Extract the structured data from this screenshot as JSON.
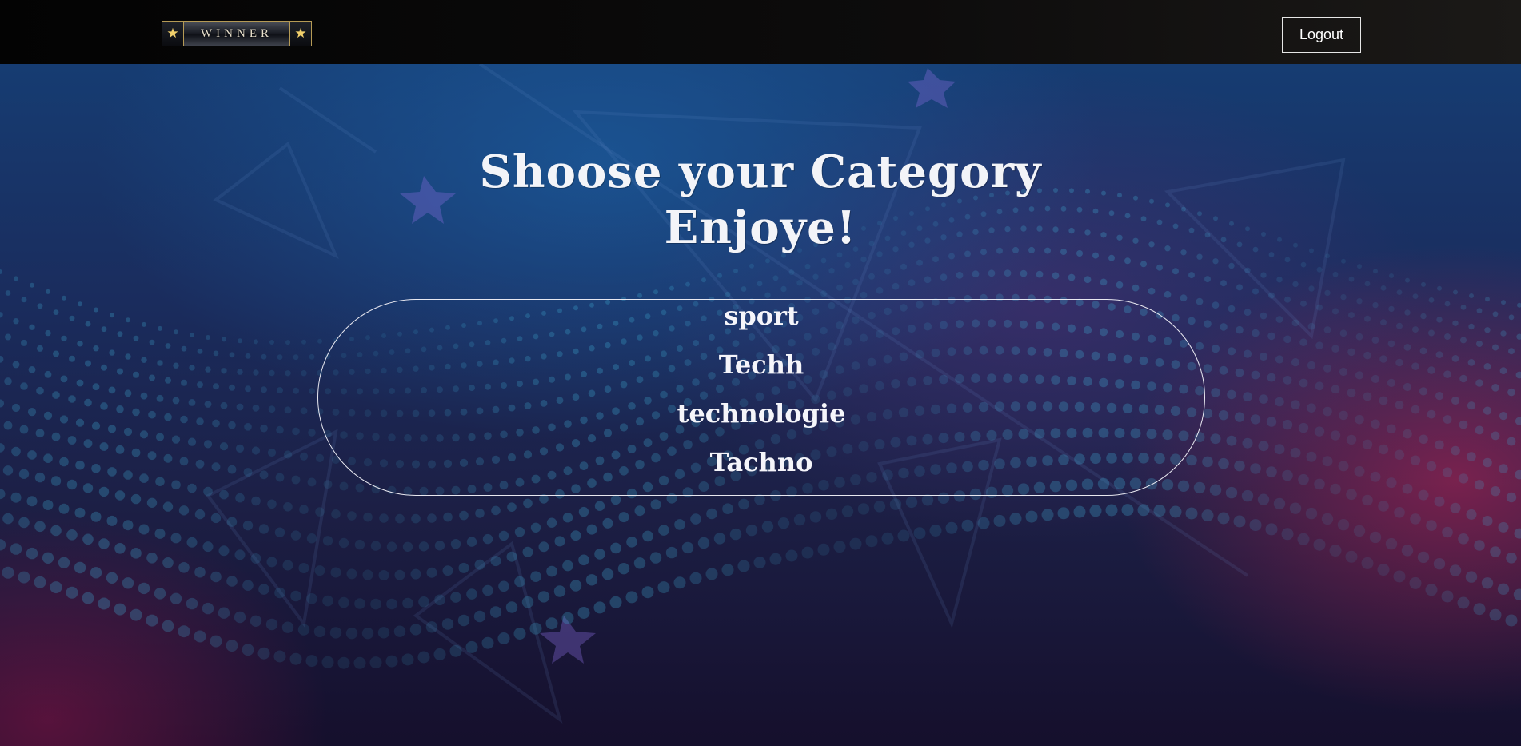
{
  "header": {
    "logo_text": "WINNER",
    "logo_star_left": "★",
    "logo_star_right": "★",
    "logout_label": "Logout"
  },
  "main": {
    "heading_line1": "Shoose your Category",
    "heading_line2": "Enjoye!",
    "categories": [
      {
        "label": "sport"
      },
      {
        "label": "Techh"
      },
      {
        "label": "technologie"
      },
      {
        "label": "Tachno"
      }
    ]
  },
  "colors": {
    "topbar": "#0b0b0d",
    "logo_border": "#b59a55",
    "star": "#f1cf6b",
    "text": "#f3f4f8",
    "background_blue": "#163c72",
    "background_magenta": "#c42252"
  }
}
